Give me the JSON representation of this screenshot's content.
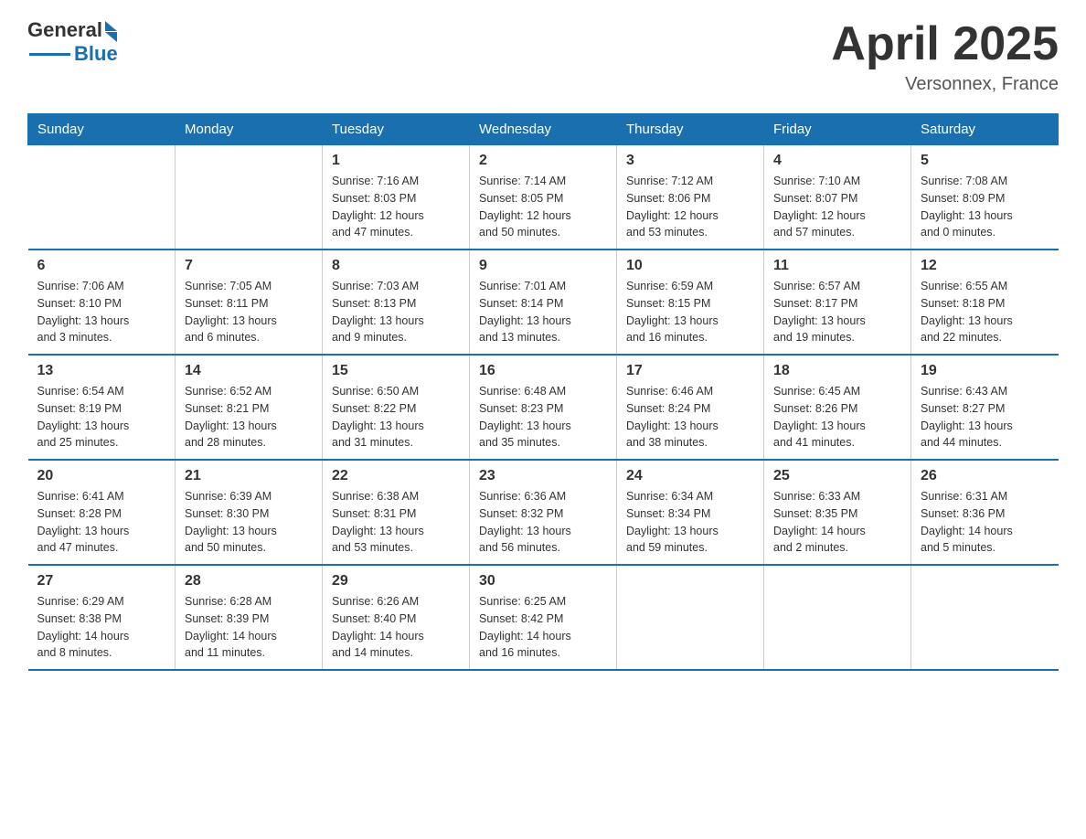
{
  "header": {
    "title": "April 2025",
    "location": "Versonnex, France",
    "logo_general": "General",
    "logo_blue": "Blue"
  },
  "days_of_week": [
    "Sunday",
    "Monday",
    "Tuesday",
    "Wednesday",
    "Thursday",
    "Friday",
    "Saturday"
  ],
  "weeks": [
    [
      {
        "day": "",
        "info": ""
      },
      {
        "day": "",
        "info": ""
      },
      {
        "day": "1",
        "info": "Sunrise: 7:16 AM\nSunset: 8:03 PM\nDaylight: 12 hours\nand 47 minutes."
      },
      {
        "day": "2",
        "info": "Sunrise: 7:14 AM\nSunset: 8:05 PM\nDaylight: 12 hours\nand 50 minutes."
      },
      {
        "day": "3",
        "info": "Sunrise: 7:12 AM\nSunset: 8:06 PM\nDaylight: 12 hours\nand 53 minutes."
      },
      {
        "day": "4",
        "info": "Sunrise: 7:10 AM\nSunset: 8:07 PM\nDaylight: 12 hours\nand 57 minutes."
      },
      {
        "day": "5",
        "info": "Sunrise: 7:08 AM\nSunset: 8:09 PM\nDaylight: 13 hours\nand 0 minutes."
      }
    ],
    [
      {
        "day": "6",
        "info": "Sunrise: 7:06 AM\nSunset: 8:10 PM\nDaylight: 13 hours\nand 3 minutes."
      },
      {
        "day": "7",
        "info": "Sunrise: 7:05 AM\nSunset: 8:11 PM\nDaylight: 13 hours\nand 6 minutes."
      },
      {
        "day": "8",
        "info": "Sunrise: 7:03 AM\nSunset: 8:13 PM\nDaylight: 13 hours\nand 9 minutes."
      },
      {
        "day": "9",
        "info": "Sunrise: 7:01 AM\nSunset: 8:14 PM\nDaylight: 13 hours\nand 13 minutes."
      },
      {
        "day": "10",
        "info": "Sunrise: 6:59 AM\nSunset: 8:15 PM\nDaylight: 13 hours\nand 16 minutes."
      },
      {
        "day": "11",
        "info": "Sunrise: 6:57 AM\nSunset: 8:17 PM\nDaylight: 13 hours\nand 19 minutes."
      },
      {
        "day": "12",
        "info": "Sunrise: 6:55 AM\nSunset: 8:18 PM\nDaylight: 13 hours\nand 22 minutes."
      }
    ],
    [
      {
        "day": "13",
        "info": "Sunrise: 6:54 AM\nSunset: 8:19 PM\nDaylight: 13 hours\nand 25 minutes."
      },
      {
        "day": "14",
        "info": "Sunrise: 6:52 AM\nSunset: 8:21 PM\nDaylight: 13 hours\nand 28 minutes."
      },
      {
        "day": "15",
        "info": "Sunrise: 6:50 AM\nSunset: 8:22 PM\nDaylight: 13 hours\nand 31 minutes."
      },
      {
        "day": "16",
        "info": "Sunrise: 6:48 AM\nSunset: 8:23 PM\nDaylight: 13 hours\nand 35 minutes."
      },
      {
        "day": "17",
        "info": "Sunrise: 6:46 AM\nSunset: 8:24 PM\nDaylight: 13 hours\nand 38 minutes."
      },
      {
        "day": "18",
        "info": "Sunrise: 6:45 AM\nSunset: 8:26 PM\nDaylight: 13 hours\nand 41 minutes."
      },
      {
        "day": "19",
        "info": "Sunrise: 6:43 AM\nSunset: 8:27 PM\nDaylight: 13 hours\nand 44 minutes."
      }
    ],
    [
      {
        "day": "20",
        "info": "Sunrise: 6:41 AM\nSunset: 8:28 PM\nDaylight: 13 hours\nand 47 minutes."
      },
      {
        "day": "21",
        "info": "Sunrise: 6:39 AM\nSunset: 8:30 PM\nDaylight: 13 hours\nand 50 minutes."
      },
      {
        "day": "22",
        "info": "Sunrise: 6:38 AM\nSunset: 8:31 PM\nDaylight: 13 hours\nand 53 minutes."
      },
      {
        "day": "23",
        "info": "Sunrise: 6:36 AM\nSunset: 8:32 PM\nDaylight: 13 hours\nand 56 minutes."
      },
      {
        "day": "24",
        "info": "Sunrise: 6:34 AM\nSunset: 8:34 PM\nDaylight: 13 hours\nand 59 minutes."
      },
      {
        "day": "25",
        "info": "Sunrise: 6:33 AM\nSunset: 8:35 PM\nDaylight: 14 hours\nand 2 minutes."
      },
      {
        "day": "26",
        "info": "Sunrise: 6:31 AM\nSunset: 8:36 PM\nDaylight: 14 hours\nand 5 minutes."
      }
    ],
    [
      {
        "day": "27",
        "info": "Sunrise: 6:29 AM\nSunset: 8:38 PM\nDaylight: 14 hours\nand 8 minutes."
      },
      {
        "day": "28",
        "info": "Sunrise: 6:28 AM\nSunset: 8:39 PM\nDaylight: 14 hours\nand 11 minutes."
      },
      {
        "day": "29",
        "info": "Sunrise: 6:26 AM\nSunset: 8:40 PM\nDaylight: 14 hours\nand 14 minutes."
      },
      {
        "day": "30",
        "info": "Sunrise: 6:25 AM\nSunset: 8:42 PM\nDaylight: 14 hours\nand 16 minutes."
      },
      {
        "day": "",
        "info": ""
      },
      {
        "day": "",
        "info": ""
      },
      {
        "day": "",
        "info": ""
      }
    ]
  ]
}
